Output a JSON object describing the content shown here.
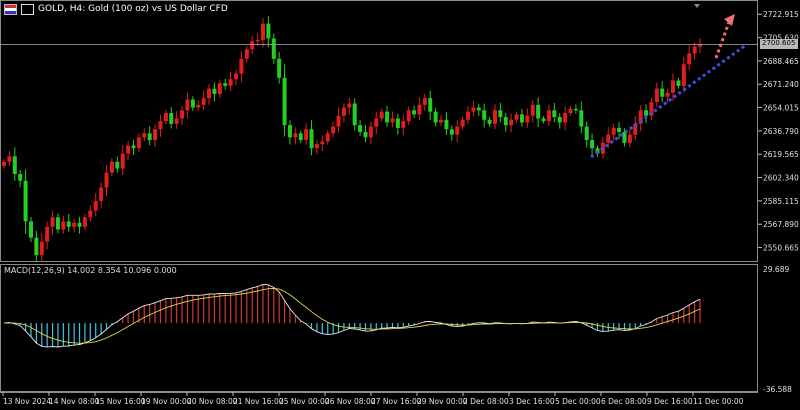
{
  "header": {
    "symbol_text": "GOLD, H4:  Gold (100 oz) vs US Dollar CFD",
    "icons": [
      "flag-icon",
      "triangle-icon"
    ]
  },
  "macd": {
    "label": "MACD(12,26,9) 14.002 8.354 10.096 0.000",
    "axis_top": "29.689",
    "axis_bottom": "-36.588"
  },
  "price_axis": {
    "labels": [
      "2722.915",
      "2705.630",
      "2688.465",
      "2671.240",
      "2654.015",
      "2636.790",
      "2619.565",
      "2602.340",
      "2585.115",
      "2567.890",
      "2550.665"
    ],
    "current_price": "2700.605"
  },
  "time_axis": {
    "labels": [
      "13 Nov 2024",
      "14 Nov 08:00",
      "15 Nov 16:00",
      "19 Nov 00:00",
      "20 Nov 08:00",
      "21 Nov 16:00",
      "25 Nov 00:00",
      "26 Nov 08:00",
      "27 Nov 16:00",
      "29 Nov 00:00",
      "2 Dec 08:00",
      "3 Dec 16:00",
      "5 Dec 00:00",
      "6 Dec 08:00",
      "9 Dec 16:00",
      "11 Dec 00:00"
    ]
  },
  "colors": {
    "bull": "#e31d1d",
    "bear": "#22d022",
    "macd_pos": "#d13b2e",
    "macd_neg": "#3ec6e6",
    "signal": "#e3d34a",
    "macd_line": "#e8e8e8",
    "trendline": "#3a50e0",
    "projection": "#f07070"
  },
  "chart_data": {
    "type": "candlestick",
    "y_range": [
      2540,
      2729
    ],
    "closes": [
      2614,
      2618,
      2605,
      2600,
      2570,
      2558,
      2545,
      2555,
      2566,
      2573,
      2564,
      2570,
      2566,
      2569,
      2566,
      2573,
      2578,
      2585,
      2595,
      2606,
      2614,
      2609,
      2620,
      2626,
      2624,
      2632,
      2635,
      2630,
      2638,
      2644,
      2650,
      2642,
      2646,
      2652,
      2660,
      2654,
      2656,
      2661,
      2668,
      2664,
      2672,
      2670,
      2675,
      2679,
      2690,
      2697,
      2703,
      2704,
      2716,
      2705,
      2690,
      2676,
      2641,
      2632,
      2635,
      2630,
      2638,
      2624,
      2627,
      2629,
      2635,
      2640,
      2648,
      2654,
      2657,
      2641,
      2636,
      2632,
      2640,
      2646,
      2651,
      2643,
      2646,
      2639,
      2644,
      2652,
      2649,
      2656,
      2661,
      2651,
      2643,
      2645,
      2638,
      2634,
      2640,
      2645,
      2651,
      2654,
      2652,
      2645,
      2642,
      2652,
      2647,
      2641,
      2645,
      2649,
      2643,
      2648,
      2656,
      2646,
      2644,
      2652,
      2647,
      2643,
      2650,
      2653,
      2652,
      2640,
      2630,
      2624,
      2620,
      2628,
      2634,
      2639,
      2636,
      2628,
      2634,
      2642,
      2652,
      2648,
      2658,
      2668,
      2662,
      2665,
      2674,
      2670,
      2686,
      2694,
      2699,
      2701
    ]
  }
}
